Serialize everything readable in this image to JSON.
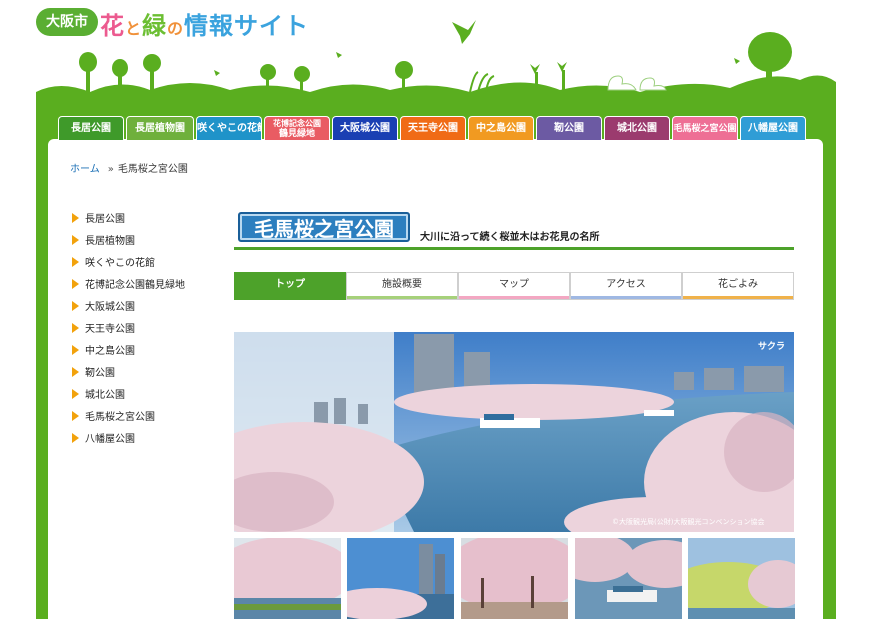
{
  "logo": {
    "badge": "大阪市",
    "title_parts": [
      "花",
      "と",
      "緑",
      "の",
      "情報サイト"
    ]
  },
  "nav": {
    "items": [
      {
        "label": "長居公園",
        "color": "#3f9a2a"
      },
      {
        "label": "長居植物園",
        "color": "#6fb03c"
      },
      {
        "label": "咲くやこの花館",
        "color": "#1f93c9"
      },
      {
        "label": "花博記念公園鶴見緑地",
        "line1": "花博記念公園",
        "line2": "鶴見緑地",
        "color": "#e95c63"
      },
      {
        "label": "大阪城公園",
        "color": "#1a3fb3"
      },
      {
        "label": "天王寺公園",
        "color": "#f06b16"
      },
      {
        "label": "中之島公園",
        "color": "#f19a21"
      },
      {
        "label": "靭公園",
        "color": "#6c5aa3"
      },
      {
        "label": "城北公園",
        "color": "#9b3b6e"
      },
      {
        "label": "毛馬桜之宮公園",
        "color": "#ee6f95"
      },
      {
        "label": "八幡屋公園",
        "color": "#2f9dd6"
      }
    ]
  },
  "breadcrumb": {
    "home": "ホーム",
    "current": "毛馬桜之宮公園"
  },
  "sidemenu": {
    "items": [
      "長居公園",
      "長居植物園",
      "咲くやこの花館",
      "花博記念公園鶴見緑地",
      "大阪城公園",
      "天王寺公園",
      "中之島公園",
      "靭公園",
      "城北公園",
      "毛馬桜之宮公園",
      "八幡屋公園"
    ]
  },
  "page": {
    "title": "毛馬桜之宮公園",
    "subtitle": "大川に沿って続く桜並木はお花見の名所"
  },
  "tabs": [
    {
      "label": "トップ",
      "active": true,
      "accent": "#4da22a"
    },
    {
      "label": "施設概要",
      "active": false,
      "accent": "#a6d17a"
    },
    {
      "label": "マップ",
      "active": false,
      "accent": "#f3a7c2"
    },
    {
      "label": "アクセス",
      "active": false,
      "accent": "#9fb8e3"
    },
    {
      "label": "花ごよみ",
      "active": false,
      "accent": "#f0b24a"
    }
  ],
  "photo": {
    "label": "サクラ",
    "credit": "©大阪観光局(公財)大阪観光コンベンション協会"
  },
  "colors": {
    "frame_green": "#5aae1f",
    "accent_orange": "#f2a20c",
    "link_blue": "#1a6fb5"
  }
}
